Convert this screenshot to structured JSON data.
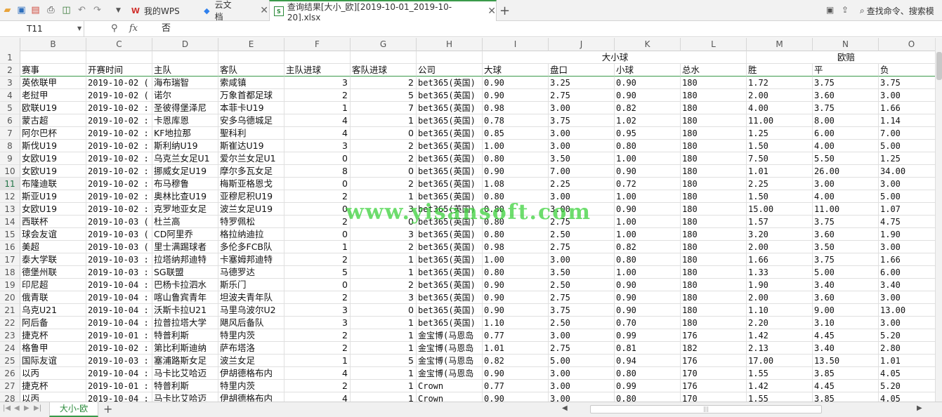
{
  "tabs": {
    "wps_label": "我的WPS",
    "cloud_label": "云文档",
    "file_label": "查询结果[大小_欧][2019-10-01_2019-10-20].xlsx"
  },
  "search": {
    "label": "查找命令、搜索模"
  },
  "formula": {
    "cell_ref": "T11",
    "value": "否"
  },
  "columns": [
    "B",
    "C",
    "D",
    "E",
    "F",
    "G",
    "H",
    "I",
    "J",
    "K",
    "L",
    "M",
    "N",
    "O"
  ],
  "active_row": 11,
  "row1": {
    "daxiaoqiu": "大小球",
    "ouipei": "欧赔"
  },
  "headers": [
    "赛事",
    "开赛时间",
    "主队",
    "客队",
    "主队进球",
    "客队进球",
    "公司",
    "大球",
    "盘口",
    "小球",
    "总水",
    "胜",
    "平",
    "负"
  ],
  "rows": [
    [
      "英依联甲",
      "2019-10-02 (",
      "海布瑞智",
      "索咸镇",
      "3",
      "2",
      "bet365(英国)",
      "0.90",
      "3.25",
      "0.90",
      "180",
      "1.72",
      "3.75",
      "3.75"
    ],
    [
      "老挝甲",
      "2019-10-02 (",
      "诺尔",
      "万象首都足球",
      "2",
      "5",
      "bet365(英国)",
      "0.90",
      "2.75",
      "0.90",
      "180",
      "2.00",
      "3.60",
      "3.00"
    ],
    [
      "欧联U19",
      "2019-10-02 :",
      "圣彼得堡泽尼",
      "本菲卡U19",
      "1",
      "7",
      "bet365(英国)",
      "0.98",
      "3.00",
      "0.82",
      "180",
      "4.00",
      "3.75",
      "1.66"
    ],
    [
      "蒙古超",
      "2019-10-02 :",
      "卡恩库恩",
      "安多乌德城足",
      "4",
      "1",
      "bet365(英国)",
      "0.78",
      "3.75",
      "1.02",
      "180",
      "11.00",
      "8.00",
      "1.14"
    ],
    [
      "阿尔巴杯",
      "2019-10-02 :",
      "KF地拉那",
      "聖科利",
      "4",
      "0",
      "bet365(英国)",
      "0.85",
      "3.00",
      "0.95",
      "180",
      "1.25",
      "6.00",
      "7.00"
    ],
    [
      "斯伐U19",
      "2019-10-02 :",
      "斯利纳U19",
      "斯崔达U19",
      "3",
      "2",
      "bet365(英国)",
      "1.00",
      "3.00",
      "0.80",
      "180",
      "1.50",
      "4.00",
      "5.00"
    ],
    [
      "女欧U19",
      "2019-10-02 :",
      "乌克兰女足U1",
      "爱尔兰女足U1",
      "0",
      "2",
      "bet365(英国)",
      "0.80",
      "3.50",
      "1.00",
      "180",
      "7.50",
      "5.50",
      "1.25"
    ],
    [
      "女欧U19",
      "2019-10-02 :",
      "挪威女足U19",
      "摩尔多瓦女足",
      "8",
      "0",
      "bet365(英国)",
      "0.90",
      "7.00",
      "0.90",
      "180",
      "1.01",
      "26.00",
      "34.00"
    ],
    [
      "布隆迪联",
      "2019-10-02 :",
      "布马穆鲁",
      "梅斯亚格恩戈",
      "0",
      "2",
      "bet365(英国)",
      "1.08",
      "2.25",
      "0.72",
      "180",
      "2.25",
      "3.00",
      "3.00"
    ],
    [
      "斯亚U19",
      "2019-10-02 :",
      "奥林比查U19",
      "亚穆尼积U19",
      "2",
      "1",
      "bet365(英国)",
      "0.80",
      "3.00",
      "1.00",
      "180",
      "1.50",
      "4.00",
      "5.00"
    ],
    [
      "女欧U19",
      "2019-10-02 :",
      "克罗地亚女足",
      "波兰女足U19",
      "0",
      "3",
      "bet365(英国)",
      "0.80",
      "3.00",
      "0.90",
      "180",
      "15.00",
      "11.00",
      "1.07"
    ],
    [
      "西联杯",
      "2019-10-03 (",
      "杜兰高",
      "特罗佩松",
      "2",
      "0",
      "bet365(英国)",
      "0.80",
      "2.75",
      "1.00",
      "180",
      "1.57",
      "3.75",
      "4.75"
    ],
    [
      "球会友谊",
      "2019-10-03 (",
      "CD阿里乔",
      "格拉纳迪拉",
      "0",
      "3",
      "bet365(英国)",
      "0.80",
      "2.50",
      "1.00",
      "180",
      "3.20",
      "3.60",
      "1.90"
    ],
    [
      "美超",
      "2019-10-03 (",
      "里士满踢球者",
      "多伦多FCB队",
      "1",
      "2",
      "bet365(英国)",
      "0.98",
      "2.75",
      "0.82",
      "180",
      "2.00",
      "3.50",
      "3.00"
    ],
    [
      "泰大学联",
      "2019-10-03 :",
      "拉塔纳邦迪特",
      "卡塞姆邦迪特",
      "2",
      "1",
      "bet365(英国)",
      "1.00",
      "3.00",
      "0.80",
      "180",
      "1.66",
      "3.75",
      "1.66"
    ],
    [
      "德堡州联",
      "2019-10-03 :",
      "SG联盟",
      "马德罗达",
      "5",
      "1",
      "bet365(英国)",
      "0.80",
      "3.50",
      "1.00",
      "180",
      "1.33",
      "5.00",
      "6.00"
    ],
    [
      "印尼超",
      "2019-10-04 :",
      "巴杨卡拉泗水",
      "斯乐门",
      "0",
      "2",
      "bet365(英国)",
      "0.90",
      "2.50",
      "0.90",
      "180",
      "1.90",
      "3.40",
      "3.40"
    ],
    [
      "俄青联",
      "2019-10-04 :",
      "喀山鲁宾青年",
      "坦波夫青年队",
      "2",
      "3",
      "bet365(英国)",
      "0.90",
      "2.75",
      "0.90",
      "180",
      "2.00",
      "3.60",
      "3.00"
    ],
    [
      "乌克U21",
      "2019-10-04 :",
      "沃斯卡拉U21",
      "马里乌波尔U2",
      "3",
      "0",
      "bet365(英国)",
      "0.90",
      "3.75",
      "0.90",
      "180",
      "1.10",
      "9.00",
      "13.00"
    ],
    [
      "阿后备",
      "2019-10-04 :",
      "拉普拉塔大学",
      "飓风后备队",
      "3",
      "1",
      "bet365(英国)",
      "1.10",
      "2.50",
      "0.70",
      "180",
      "2.20",
      "3.10",
      "3.00"
    ],
    [
      "捷克杯",
      "2019-10-01 :",
      "特普利斯",
      "特里内茨",
      "2",
      "1",
      "金宝博(马恩岛",
      "0.77",
      "3.00",
      "0.99",
      "176",
      "1.42",
      "4.45",
      "5.20"
    ],
    [
      "格鲁甲",
      "2019-10-02 :",
      "第比利斯迪纳",
      "萨布塔洛",
      "2",
      "1",
      "金宝博(马恩岛",
      "1.01",
      "2.75",
      "0.81",
      "182",
      "2.13",
      "3.40",
      "2.80"
    ],
    [
      "国际友谊",
      "2019-10-03 :",
      "塞浦路斯女足",
      "波兰女足",
      "1",
      "5",
      "金宝博(马恩岛",
      "0.82",
      "5.00",
      "0.94",
      "176",
      "17.00",
      "13.50",
      "1.01"
    ],
    [
      "以丙",
      "2019-10-04 :",
      "马卡比艾哈迈",
      "伊胡德格布内",
      "4",
      "1",
      "金宝博(马恩岛",
      "0.90",
      "3.00",
      "0.80",
      "170",
      "1.55",
      "3.85",
      "4.05"
    ],
    [
      "捷克杯",
      "2019-10-01 :",
      "特普利斯",
      "特里内茨",
      "2",
      "1",
      "Crown",
      "0.77",
      "3.00",
      "0.99",
      "176",
      "1.42",
      "4.45",
      "5.20"
    ],
    [
      "以丙",
      "2019-10-04 :",
      "马卡比艾哈迈",
      "伊胡德格布内",
      "4",
      "1",
      "Crown",
      "0.90",
      "3.00",
      "0.80",
      "170",
      "1.55",
      "3.85",
      "4.05"
    ]
  ],
  "watermark": "www.yisansoft.com",
  "sheet_tab": "大小-欧"
}
